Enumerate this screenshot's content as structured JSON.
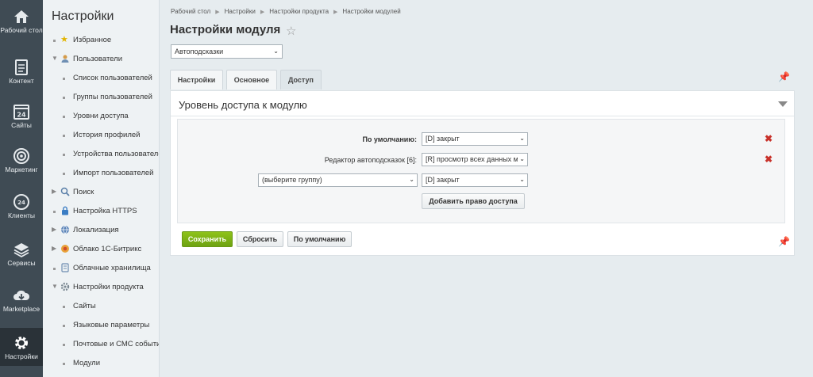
{
  "left_panel": {
    "items": [
      {
        "label": "Рабочий стол",
        "icon": "home-icon"
      },
      {
        "label": "Контент",
        "icon": "document-icon"
      },
      {
        "label": "Сайты",
        "icon": "calendar-icon"
      },
      {
        "label": "Маркетинг",
        "icon": "target-icon"
      },
      {
        "label": "Клиенты",
        "icon": "clock-icon"
      },
      {
        "label": "Сервисы",
        "icon": "layers-icon"
      },
      {
        "label": "Marketplace",
        "icon": "cloud-download-icon"
      },
      {
        "label": "Настройки",
        "icon": "gear-icon"
      }
    ]
  },
  "menu": {
    "title": "Настройки",
    "items": [
      {
        "label": "Избранное"
      },
      {
        "label": "Пользователи"
      },
      {
        "label": "Список пользователей"
      },
      {
        "label": "Группы пользователей"
      },
      {
        "label": "Уровни доступа"
      },
      {
        "label": "История профилей"
      },
      {
        "label": "Устройства пользователей"
      },
      {
        "label": "Импорт пользователей"
      },
      {
        "label": "Поиск"
      },
      {
        "label": "Настройка HTTPS"
      },
      {
        "label": "Локализация"
      },
      {
        "label": "Облако 1С-Битрикс"
      },
      {
        "label": "Облачные хранилища"
      },
      {
        "label": "Настройки продукта"
      },
      {
        "label": "Сайты"
      },
      {
        "label": "Языковые параметры"
      },
      {
        "label": "Почтовые и СМС события"
      },
      {
        "label": "Модули"
      }
    ]
  },
  "breadcrumb": [
    "Рабочий стол",
    "Настройки",
    "Настройки продукта",
    "Настройки модулей"
  ],
  "page_title": "Настройки модуля",
  "module_select": "Автоподсказки",
  "tabs": [
    "Настройки",
    "Основное",
    "Доступ"
  ],
  "panel": {
    "title": "Уровень доступа к модулю",
    "rows": [
      {
        "label": "По умолчанию:",
        "value": "[D] закрыт"
      },
      {
        "label": "Редактор автоподсказок [6]:",
        "value": "[R] просмотр всех данных м"
      },
      {
        "group_placeholder": "(выберите группу)",
        "value": "[D] закрыт"
      }
    ],
    "add_button": "Добавить право доступа"
  },
  "buttons": {
    "save": "Сохранить",
    "reset": "Сбросить",
    "default": "По умолчанию"
  },
  "colors": {
    "left_panel": "#3f4b54",
    "save_button": "#7cb316",
    "delete": "#c8312a"
  }
}
